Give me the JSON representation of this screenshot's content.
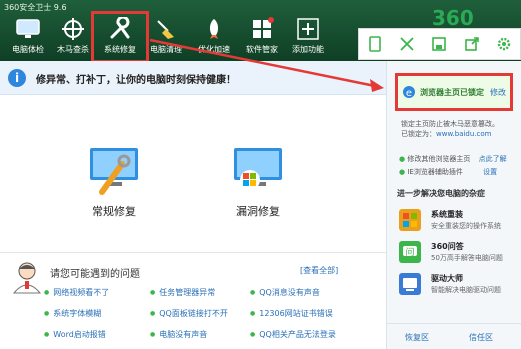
{
  "app": {
    "title": "360安全卫士 9.6",
    "logo": "360"
  },
  "toolbar": [
    {
      "label": "电脑体检",
      "icon": "monitor-icon"
    },
    {
      "label": "木马查杀",
      "icon": "crosshair-icon"
    },
    {
      "label": "系统修复",
      "icon": "wrench-icon"
    },
    {
      "label": "电脑清理",
      "icon": "broom-icon"
    },
    {
      "label": "优化加速",
      "icon": "rocket-icon"
    },
    {
      "label": "软件管家",
      "icon": "apps-icon"
    },
    {
      "label": "添加功能",
      "icon": "plus-icon"
    }
  ],
  "floating_tools": [
    "tablet-icon",
    "expand-icon",
    "save-icon",
    "share-icon",
    "gear-icon"
  ],
  "banner": {
    "text": "修异常、打补丁，让你的电脑时刻保持健康！"
  },
  "repairs": [
    {
      "label": "常规修复"
    },
    {
      "label": "漏洞修复"
    }
  ],
  "questions": {
    "title": "请您可能遇到的问题",
    "view_all": "[查看全部]",
    "items": [
      [
        "网络视频看不了",
        "任务管理器异常",
        "QQ消息没有声音"
      ],
      [
        "系统字体模糊",
        "QQ面板链接打不开",
        "12306网站证书错误"
      ],
      [
        "Word启动报错",
        "电脑没有声音",
        "QQ相关产品无法登录"
      ]
    ]
  },
  "right_panel": {
    "status_text": "浏览器主页已锁定",
    "status_link": "修改",
    "lock_desc_line1": "锁定主页防止被木马恶意篡改。",
    "lock_desc_prefix": "已锁定为：",
    "lock_url": "www.baidu.com",
    "option1": "修改其他浏览器主页",
    "option1_link": "点此了解",
    "option2": "IE浏览器辅助插件",
    "option2_link": "设置",
    "section_title": "进一步解决您电脑的杂症",
    "apps": [
      {
        "name": "系统重装",
        "desc": "安全重装您的操作系统",
        "color": "#e9a11b",
        "icon": "windows-icon"
      },
      {
        "name": "360问答",
        "desc": "50万高手解答电脑问题",
        "color": "#3cb54a",
        "icon": "question-icon"
      },
      {
        "name": "驱动大师",
        "desc": "智能解决电脑驱动问题",
        "color": "#3a7bd5",
        "icon": "driver-icon"
      }
    ],
    "footer_left": "恢复区",
    "footer_right": "信任区"
  }
}
